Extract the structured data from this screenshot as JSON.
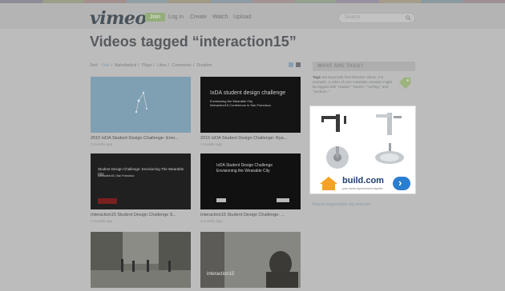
{
  "header": {
    "logo": "vimeo",
    "nav": [
      "Join",
      "Log in",
      "Create",
      "Watch",
      "Upload"
    ],
    "search_placeholder": "Search"
  },
  "page_title": "Videos tagged “interaction15”",
  "sort": {
    "prefix": "Sort:",
    "items": [
      "Date",
      "Alphabetical",
      "Plays",
      "Likes",
      "Comments",
      "Duration"
    ],
    "active": "Date"
  },
  "videos": [
    {
      "title": "2015 IxDA Student Design Challenge- Emo...",
      "meta": "3 months ago",
      "thumb_lines": []
    },
    {
      "title": "2015 IxDA Student Design Challenge: Rya...",
      "meta": "3 months ago",
      "thumb_lines": [
        "IxDA student design challenge",
        "Envisioning the Wearable City",
        "Interaction15 Conference in San Francisco"
      ]
    },
    {
      "title": "Interaction15 Student Design Challenge S...",
      "meta": "3 months ago",
      "thumb_lines": [
        "Student Design Challenge: Envisioning The Wearable City",
        "Interaction15 | San Francisco"
      ]
    },
    {
      "title": "Interaction15 Student Design Challenge: ...",
      "meta": "3 months ago",
      "thumb_lines": [
        "IxDA Student Design Challenge",
        "Envisioning the Wearable City"
      ]
    },
    {
      "title": "",
      "meta": "",
      "thumb_lines": []
    },
    {
      "title": "",
      "meta": "",
      "thumb_lines": [
        "interaction15"
      ]
    }
  ],
  "sidebar": {
    "heading": "WHAT ARE TAGS?",
    "tags_bold": "Tags",
    "tags_text": "are keywords that describe videos. For example, a video of your Hawaiian vacation might be tagged with \"Hawaii,\" \"beach,\" \"surfing,\" and \"sunburn.\"",
    "report_link": "Report suggestable tag behavior"
  },
  "ad": {
    "brand": "build.com",
    "tagline": "your home improvement experts"
  },
  "colors": {
    "page_bg": "#bcbcbc",
    "join_green": "#94ad7a",
    "ad_blue": "#2a7ed0"
  }
}
